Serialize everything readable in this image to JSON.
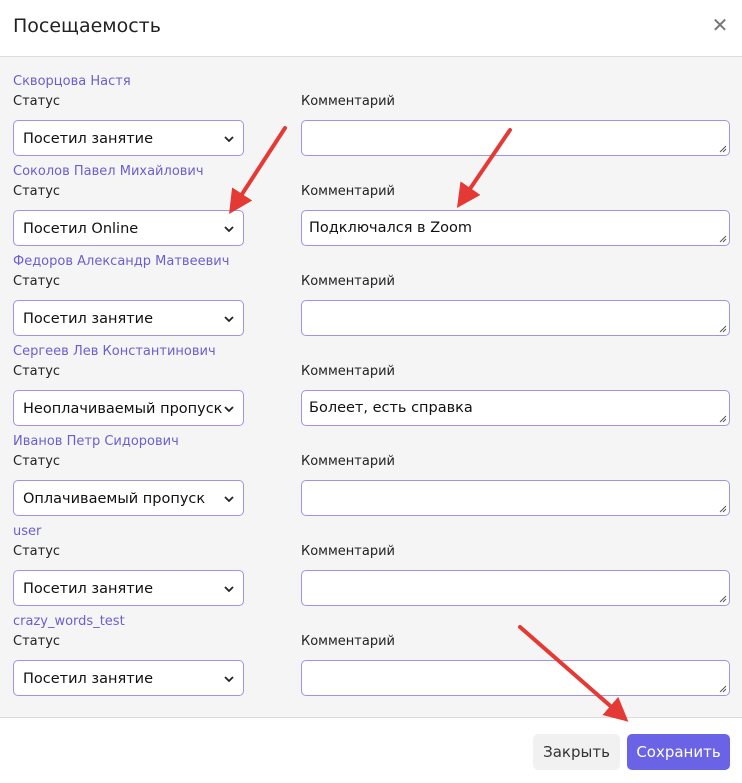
{
  "modal": {
    "title": "Посещаемость",
    "close_icon": "close-icon"
  },
  "labels": {
    "status": "Статус",
    "comment": "Комментарий"
  },
  "students": [
    {
      "name": "Скворцова Настя",
      "status": "Посетил занятие",
      "comment": ""
    },
    {
      "name": "Соколов Павел Михайлович",
      "status": "Посетил Online",
      "comment": "Подключался в Zoom"
    },
    {
      "name": "Федоров Александр Матвеевич",
      "status": "Посетил занятие",
      "comment": ""
    },
    {
      "name": "Сергеев Лев Константинович",
      "status": "Неоплачиваемый пропуск",
      "comment": "Болеет, есть справка"
    },
    {
      "name": "Иванов Петр Сидорович",
      "status": "Оплачиваемый пропуск",
      "comment": ""
    },
    {
      "name": "user",
      "status": "Посетил занятие",
      "comment": ""
    },
    {
      "name": "crazy_words_test",
      "status": "Посетил занятие",
      "comment": ""
    }
  ],
  "footer": {
    "close_label": "Закрыть",
    "save_label": "Сохранить"
  },
  "colors": {
    "accent": "#6b63e6",
    "name_link": "#6a5fd1",
    "annotation_arrow": "#e53935"
  },
  "icons": [
    "close-icon",
    "chevron-down-icon",
    "resize-handle-icon",
    "annotation-arrow-icon"
  ]
}
